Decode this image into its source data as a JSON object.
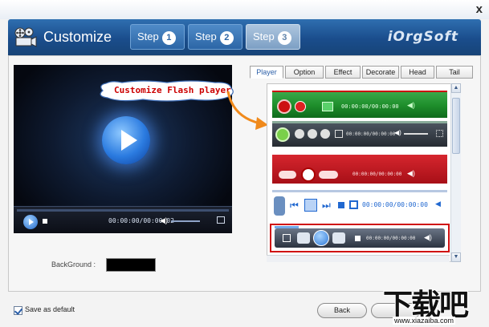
{
  "window": {
    "close_label": "x"
  },
  "header": {
    "title": "Customize",
    "brand": "iOrgSoft",
    "steps": [
      {
        "label": "Step",
        "num": "1",
        "active": false
      },
      {
        "label": "Step",
        "num": "2",
        "active": false
      },
      {
        "label": "Step",
        "num": "3",
        "active": true
      }
    ]
  },
  "preview": {
    "time": "00:00:00/00:00:02",
    "background_label": "BackGround :",
    "background_color": "#000000"
  },
  "callout": {
    "text": "Customize Flash player"
  },
  "tabs": [
    {
      "label": "Player",
      "active": true
    },
    {
      "label": "Option",
      "active": false
    },
    {
      "label": "Effect",
      "active": false
    },
    {
      "label": "Decorate",
      "active": false
    },
    {
      "label": "Head",
      "active": false
    },
    {
      "label": "Tail",
      "active": false
    }
  ],
  "skins": [
    {
      "time": "00:00:00/00:00:00",
      "color": "#1f8f2c"
    },
    {
      "time": "00:00:00/00:00:00",
      "color": "#2a2f36"
    },
    {
      "time": "00:00:00/00:00:00",
      "color": "#b3121a"
    },
    {
      "time": "00:00:00/00:00:00",
      "color": "#2168d0"
    },
    {
      "time": "00:00:00/00:00:00",
      "color": "#2c3340",
      "selected": true
    }
  ],
  "footer": {
    "save_default_label": "Save as default",
    "save_default_checked": true,
    "back_label": "Back"
  },
  "watermark": {
    "big": "下载吧",
    "small": "www.xiazaiba.com"
  },
  "colors": {
    "header": "#1a4d8c",
    "accent": "#2a5ea8",
    "selected_border": "#d01010"
  }
}
